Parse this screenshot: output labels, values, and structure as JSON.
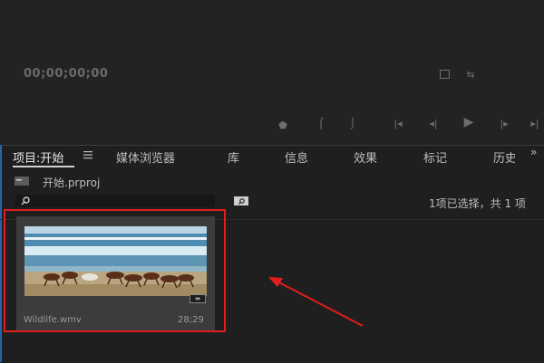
{
  "monitor": {
    "timecode": "00;00;00;00",
    "controls": [
      "marker-icon",
      "mark-in-icon",
      "mark-out-icon",
      "go-to-in-icon",
      "step-back-icon",
      "play-icon",
      "step-forward-icon",
      "go-to-out-icon"
    ]
  },
  "tabs": [
    {
      "label": "项目:开始",
      "active": true
    },
    {
      "label": "媒体浏览器"
    },
    {
      "label": "库"
    },
    {
      "label": "信息"
    },
    {
      "label": "效果"
    },
    {
      "label": "标记"
    },
    {
      "label": "历史"
    }
  ],
  "project": {
    "file_name": "开始.prproj",
    "search_placeholder": "",
    "status": "1项已选择，共 1 项"
  },
  "clip": {
    "name": "Wildlife.wmv",
    "duration": "28;29"
  },
  "colors": {
    "accent_blue": "#2b63a8",
    "highlight_red": "#e21d1d"
  }
}
